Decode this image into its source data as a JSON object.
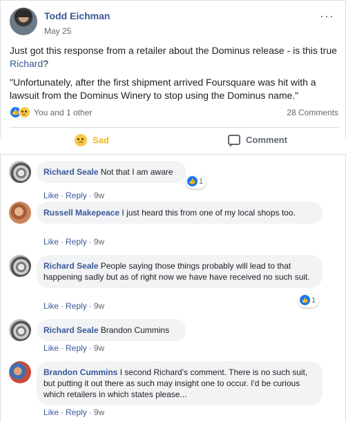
{
  "post": {
    "author": "Todd Eichman",
    "date": "May 25",
    "text_line1_pre": "Just got this response from a retailer about the Dominus release - is this true ",
    "text_mention": "Richard",
    "text_line1_post": "?",
    "quote": "\"Unfortunately, after the first shipment arrived Foursquare was hit with a lawsuit from the Dominus Winery to stop using the Dominus name.\"",
    "reactions_text": "You and 1 other",
    "comment_count": "28 Comments",
    "more_glyph": "···"
  },
  "actions": {
    "sad_label": "Sad",
    "comment_label": "Comment"
  },
  "comments": [
    {
      "name": "Richard Seale",
      "text": "Not that I am aware",
      "like": "Like",
      "reply": "Reply",
      "time": "9w",
      "reaction_count": "1"
    },
    {
      "name": "Russell Makepeace",
      "text": "I just heard this from one of my local shops too.",
      "like": "Like",
      "reply": "Reply",
      "time": "9w"
    },
    {
      "name": "Richard Seale",
      "text": "People saying those things probably will lead to that happening sadly but as of right now we have have received no such suit.",
      "like": "Like",
      "reply": "Reply",
      "time": "9w",
      "reaction_count": "1"
    },
    {
      "name": "Richard Seale",
      "text": "Brandon Cummins",
      "like": "Like",
      "reply": "Reply",
      "time": "9w"
    },
    {
      "name": "Brandon Cummins",
      "text": "I second Richard's comment. There is no such suit, but putting it out there as such may insight one to occur. I'd be curious which retailers in which states please...",
      "like": "Like",
      "reply": "Reply",
      "time": "9w"
    }
  ],
  "colors": {
    "link_blue": "#385898",
    "sad_yellow": "#f0ba15",
    "like_blue": "#1877f2",
    "bubble_gray": "#f2f3f5"
  },
  "icons": {
    "like": "thumbs-up-icon",
    "sad": "sad-face-icon",
    "comment": "speech-bubble-icon",
    "more": "more-horizontal-icon"
  }
}
